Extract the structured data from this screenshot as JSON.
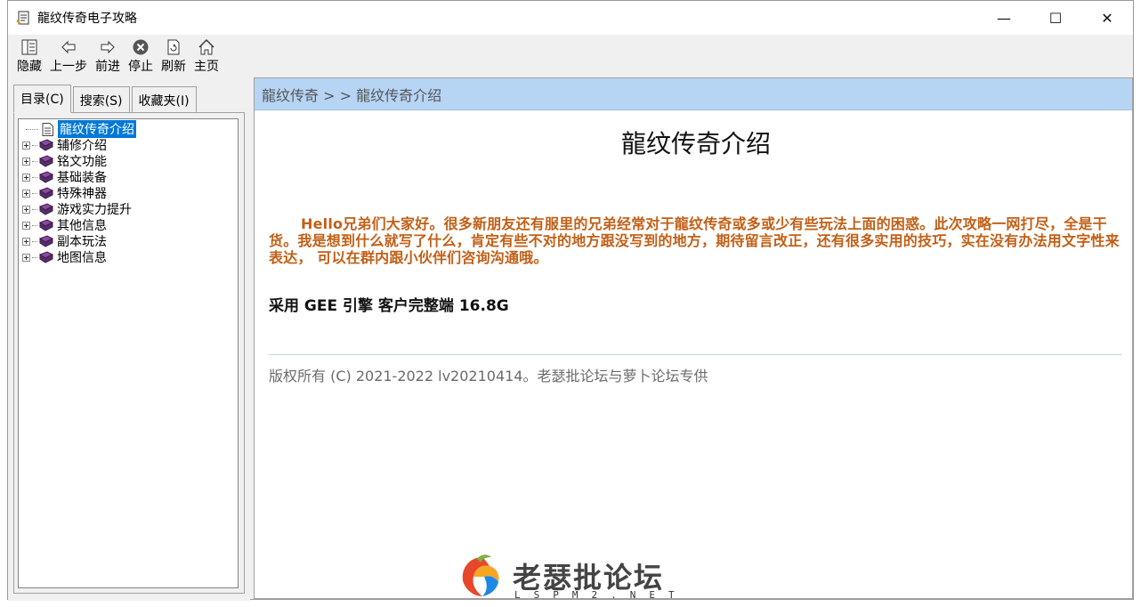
{
  "window": {
    "title": "龍纹传奇电子攻略",
    "minimize": "—",
    "maximize": "☐",
    "close": "✕"
  },
  "toolbar": {
    "hide": "隐藏",
    "back": "上一步",
    "forward": "前进",
    "stop": "停止",
    "refresh": "刷新",
    "home": "主页"
  },
  "tabs": {
    "contents": "目录(C)",
    "search": "搜索(S)",
    "favorites": "收藏夹(I)"
  },
  "tree": {
    "items": [
      {
        "label": "龍纹传奇介绍",
        "type": "page",
        "selected": true
      },
      {
        "label": "辅修介绍",
        "type": "book"
      },
      {
        "label": "铭文功能",
        "type": "book"
      },
      {
        "label": "基础装备",
        "type": "book"
      },
      {
        "label": "特殊神器",
        "type": "book"
      },
      {
        "label": "游戏实力提升",
        "type": "book"
      },
      {
        "label": "其他信息",
        "type": "book"
      },
      {
        "label": "副本玩法",
        "type": "book"
      },
      {
        "label": "地图信息",
        "type": "book"
      }
    ]
  },
  "content": {
    "breadcrumb": "龍纹传奇 > > 龍纹传奇介绍",
    "title": "龍纹传奇介绍",
    "intro": "Hello兄弟们大家好。很多新朋友还有服里的兄弟经常对于龍纹传奇或多或少有些玩法上面的困惑。此次攻略一网打尽，全是干货。我是想到什么就写了什么，肯定有些不对的地方跟没写到的地方，期待留言改正，还有很多实用的技巧，实在没有办法用文字性来表达， 可以在群内跟小伙伴们咨询沟通哦。",
    "engine": "采用 GEE 引擎  客户完整端 16.8G",
    "copyright": "版权所有 (C) 2021-2022 lv20210414。老瑟批论坛与萝卜论坛专供"
  },
  "watermark": {
    "text": "老瑟批论坛",
    "sub": "LSPM2.NET"
  },
  "colors": {
    "breadcrumb_bg": "#b6d5f5",
    "intro_text": "#c25f16",
    "selection": "#0078d7"
  }
}
